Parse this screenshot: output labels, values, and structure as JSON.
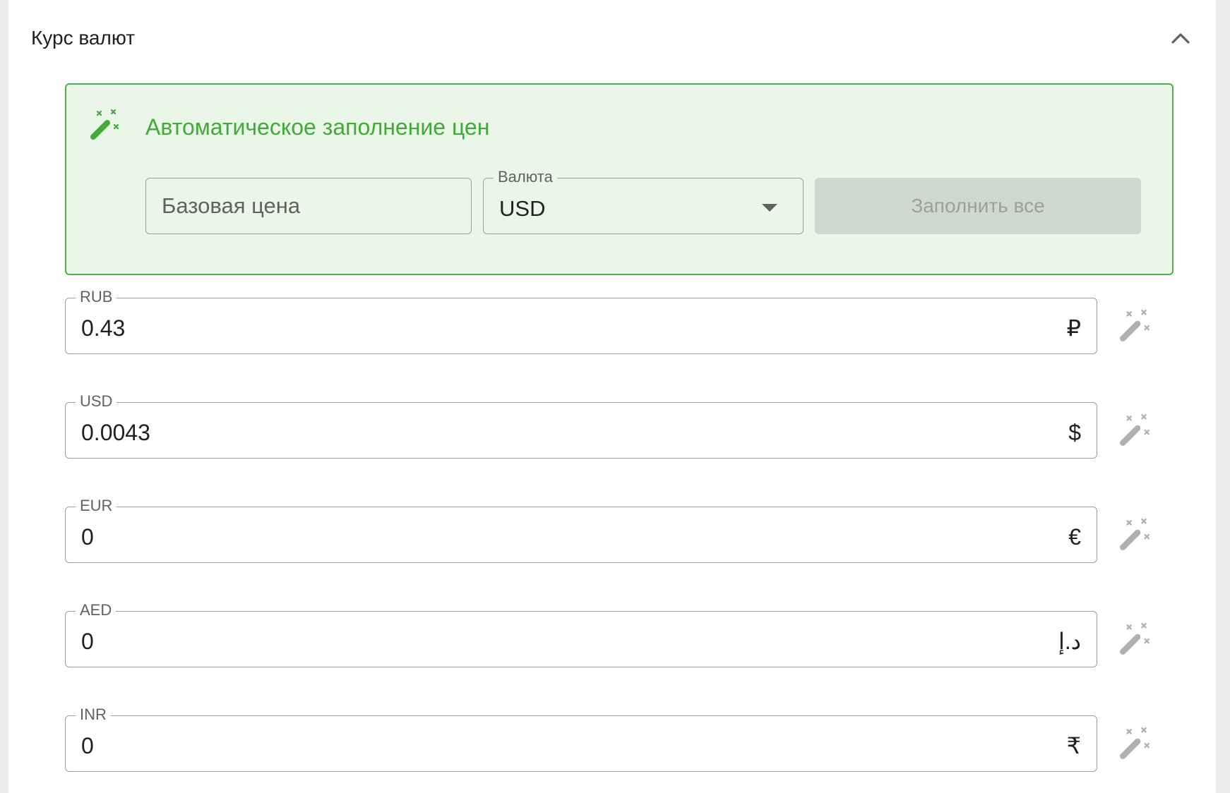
{
  "section": {
    "title": "Курс валют",
    "collapse_icon": "chevron-up-icon"
  },
  "autofill": {
    "title": "Автоматическое заполнение цен",
    "icon": "magic-wand-icon",
    "base_price_placeholder": "Базовая цена",
    "base_price_value": "",
    "currency_label": "Валюта",
    "currency_value": "USD",
    "fill_all_label": "Заполнить все",
    "colors": {
      "accent": "#43a93a",
      "border": "#4caf50",
      "background": "#eaf6e7"
    }
  },
  "rates": [
    {
      "code": "RUB",
      "value": "0.43",
      "symbol": "₽"
    },
    {
      "code": "USD",
      "value": "0.0043",
      "symbol": "$"
    },
    {
      "code": "EUR",
      "value": "0",
      "symbol": "€"
    },
    {
      "code": "AED",
      "value": "0",
      "symbol": "د.إ"
    },
    {
      "code": "INR",
      "value": "0",
      "symbol": "₹"
    }
  ]
}
